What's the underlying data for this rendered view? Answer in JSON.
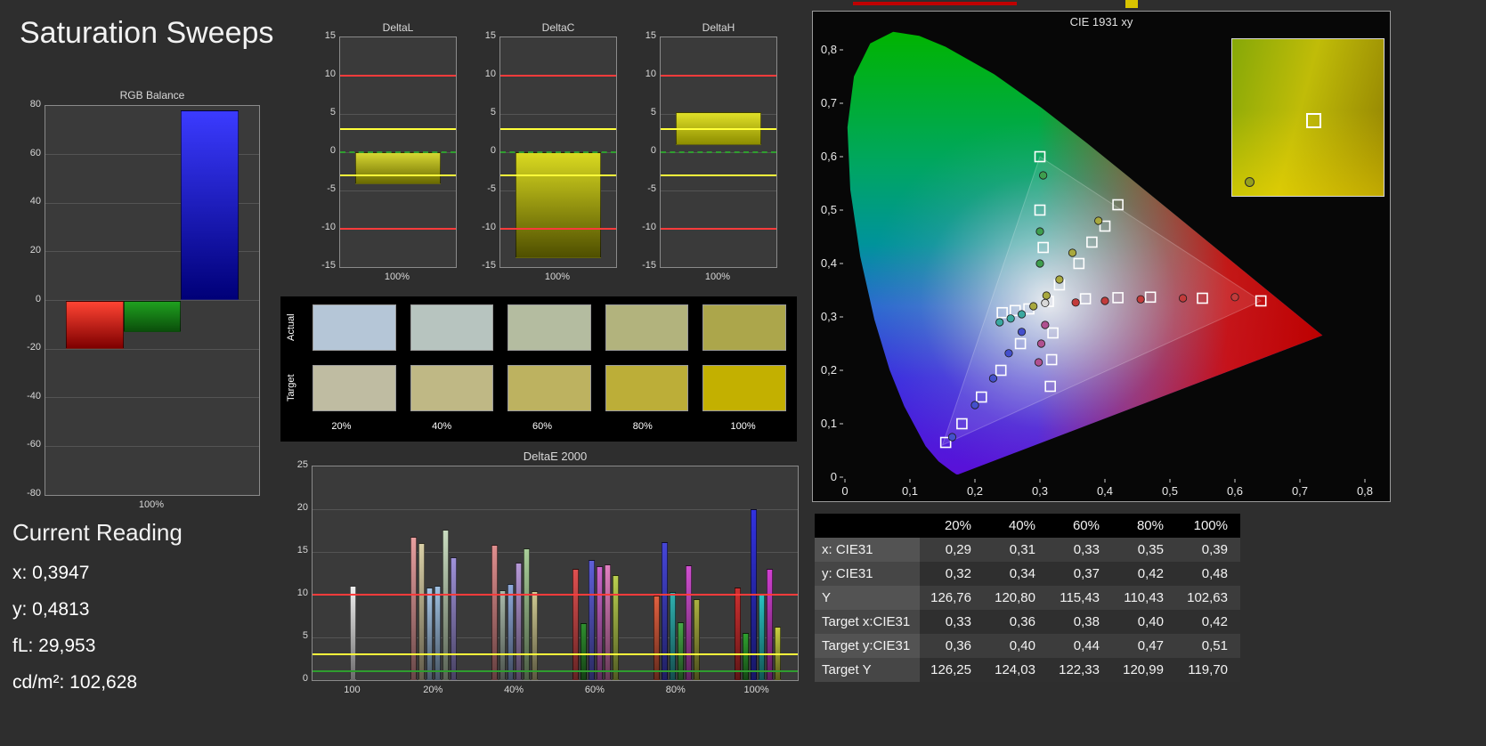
{
  "page": {
    "title": "Saturation Sweeps"
  },
  "current_reading": {
    "heading": "Current Reading",
    "lines": [
      "x: 0,3947",
      "y: 0,4813",
      "fL: 29,953",
      "cd/m²: 102,628"
    ]
  },
  "swatches": {
    "row_labels": [
      "Actual",
      "Target"
    ],
    "column_labels": [
      "20%",
      "40%",
      "60%",
      "80%",
      "100%"
    ],
    "actual_colors": [
      "#b5c6d7",
      "#b7c4bf",
      "#b4bca0",
      "#b2b37d",
      "#aca64b"
    ],
    "target_colors": [
      "#bfbca2",
      "#bfb885",
      "#bdb260",
      "#bcae38",
      "#c3b000"
    ]
  },
  "results_table": {
    "headers": [
      "",
      "20%",
      "40%",
      "60%",
      "80%",
      "100%"
    ],
    "rows": [
      {
        "label": "x: CIE31",
        "values": [
          "0,29",
          "0,31",
          "0,33",
          "0,35",
          "0,39"
        ]
      },
      {
        "label": "y: CIE31",
        "values": [
          "0,32",
          "0,34",
          "0,37",
          "0,42",
          "0,48"
        ]
      },
      {
        "label": "Y",
        "values": [
          "126,76",
          "120,80",
          "115,43",
          "110,43",
          "102,63"
        ]
      },
      {
        "label": "Target x:CIE31",
        "values": [
          "0,33",
          "0,36",
          "0,38",
          "0,40",
          "0,42"
        ]
      },
      {
        "label": "Target y:CIE31",
        "values": [
          "0,36",
          "0,40",
          "0,44",
          "0,47",
          "0,51"
        ]
      },
      {
        "label": "Target Y",
        "values": [
          "126,25",
          "124,03",
          "122,33",
          "120,99",
          "119,70"
        ]
      }
    ]
  },
  "chart_data": [
    {
      "id": "rgb_balance",
      "type": "bar",
      "title": "RGB Balance",
      "ylim": [
        -80,
        80
      ],
      "yticks": [
        80,
        60,
        40,
        20,
        0,
        -20,
        -40,
        -60,
        -80
      ],
      "xticklabels": [
        "100%"
      ],
      "series": [
        {
          "name": "Red",
          "value": -20,
          "color_top": "#ff4433",
          "color_bottom": "#7e0000"
        },
        {
          "name": "Green",
          "value": -13,
          "color_top": "#1fa01f",
          "color_bottom": "#0b4f0b"
        },
        {
          "name": "Blue",
          "value": 78,
          "color_top": "#3b3bff",
          "color_bottom": "#000078"
        }
      ]
    },
    {
      "id": "delta_l",
      "type": "bar",
      "title": "DeltaL",
      "ylim": [
        -15,
        15
      ],
      "yticks": [
        15,
        10,
        5,
        0,
        -5,
        -10,
        -15
      ],
      "xticklabels": [
        "100%"
      ],
      "reference_lines": [
        {
          "value": 10,
          "color": "#ff3b3b"
        },
        {
          "value": 3,
          "color": "#ffff3b"
        },
        {
          "value": 0,
          "color": "#2f9e2f",
          "dashed": true
        },
        {
          "value": -3,
          "color": "#ffff3b"
        },
        {
          "value": -10,
          "color": "#ff3b3b"
        }
      ],
      "bars": [
        {
          "from": 0,
          "to": -4.2,
          "color_top": "#d6d632",
          "color_bottom": "#6a6a00"
        }
      ]
    },
    {
      "id": "delta_c",
      "type": "bar",
      "title": "DeltaC",
      "ylim": [
        -15,
        15
      ],
      "yticks": [
        15,
        10,
        5,
        0,
        -5,
        -10,
        -15
      ],
      "xticklabels": [
        "100%"
      ],
      "reference_lines": [
        {
          "value": 10,
          "color": "#ff3b3b"
        },
        {
          "value": 3,
          "color": "#ffff3b"
        },
        {
          "value": 0,
          "color": "#2f9e2f",
          "dashed": true
        },
        {
          "value": -3,
          "color": "#ffff3b"
        },
        {
          "value": -10,
          "color": "#ff3b3b"
        }
      ],
      "bars": [
        {
          "from": 0,
          "to": -13.8,
          "color_top": "#d9d920",
          "color_bottom": "#4f4f00"
        }
      ]
    },
    {
      "id": "delta_h",
      "type": "bar",
      "title": "DeltaH",
      "ylim": [
        -15,
        15
      ],
      "yticks": [
        15,
        10,
        5,
        0,
        -5,
        -10,
        -15
      ],
      "xticklabels": [
        "100%"
      ],
      "reference_lines": [
        {
          "value": 10,
          "color": "#ff3b3b"
        },
        {
          "value": 3,
          "color": "#ffff3b"
        },
        {
          "value": 0,
          "color": "#2f9e2f",
          "dashed": true
        },
        {
          "value": -3,
          "color": "#ffff3b"
        },
        {
          "value": -10,
          "color": "#ff3b3b"
        }
      ],
      "bars": [
        {
          "from": 0.9,
          "to": 5.2,
          "color_top": "#e0e028",
          "color_bottom": "#8d8d00"
        }
      ]
    },
    {
      "id": "delta_e_2000",
      "type": "grouped_bar",
      "title": "DeltaE 2000",
      "ylim": [
        0,
        25
      ],
      "yticks": [
        25,
        20,
        15,
        10,
        5,
        0
      ],
      "reference_lines": [
        {
          "value": 10,
          "color": "#ff3b3b"
        },
        {
          "value": 3,
          "color": "#ffff3b"
        },
        {
          "value": 1,
          "color": "#2f9e2f"
        }
      ],
      "groups": [
        {
          "label": "100",
          "bars": [
            {
              "color": "#f0f0f0",
              "value": 11.0
            }
          ]
        },
        {
          "label": "20%",
          "bars": [
            {
              "color": "#e89f9f",
              "value": 16.8
            },
            {
              "color": "#d9cfa6",
              "value": 16.0
            },
            {
              "color": "#a6c6e6",
              "value": 10.8
            },
            {
              "color": "#9fc0e0",
              "value": 11.0
            },
            {
              "color": "#c9dcc0",
              "value": 17.6
            },
            {
              "color": "#9f92d9",
              "value": 14.4
            }
          ]
        },
        {
          "label": "40%",
          "bars": [
            {
              "color": "#e08f8f",
              "value": 15.8
            },
            {
              "color": "#a9b9aa",
              "value": 10.5
            },
            {
              "color": "#8fa9d9",
              "value": 11.2
            },
            {
              "color": "#b699d6",
              "value": 13.8
            },
            {
              "color": "#a9cf99",
              "value": 15.4
            },
            {
              "color": "#cfc892",
              "value": 10.4
            }
          ]
        },
        {
          "label": "60%",
          "bars": [
            {
              "color": "#e05050",
              "value": 13.0
            },
            {
              "color": "#2f8f2f",
              "value": 6.7
            },
            {
              "color": "#5f5fd9",
              "value": 14.1
            },
            {
              "color": "#cc66cc",
              "value": 13.3
            },
            {
              "color": "#e080c0",
              "value": 13.5
            },
            {
              "color": "#b9cf50",
              "value": 12.3
            }
          ]
        },
        {
          "label": "80%",
          "bars": [
            {
              "color": "#e06040",
              "value": 9.9
            },
            {
              "color": "#4646d8",
              "value": 16.1
            },
            {
              "color": "#2fb0b0",
              "value": 10.3
            },
            {
              "color": "#46a846",
              "value": 6.8
            },
            {
              "color": "#d050d0",
              "value": 13.4
            },
            {
              "color": "#aab040",
              "value": 9.5
            }
          ]
        },
        {
          "label": "100%",
          "bars": [
            {
              "color": "#d03030",
              "value": 10.8
            },
            {
              "color": "#2fa02f",
              "value": 5.5
            },
            {
              "color": "#3232e0",
              "value": 20.0
            },
            {
              "color": "#28c0c0",
              "value": 10.0
            },
            {
              "color": "#d040d0",
              "value": 13.0
            },
            {
              "color": "#c8d040",
              "value": 6.2
            }
          ]
        }
      ]
    },
    {
      "id": "cie_1931",
      "type": "scatter",
      "title": "CIE 1931 xy",
      "xlim": [
        0,
        0.8
      ],
      "ylim": [
        0,
        0.8
      ],
      "xtick_labels": [
        "0",
        "0,1",
        "0,2",
        "0,3",
        "0,4",
        "0,5",
        "0,6",
        "0,7",
        "0,8"
      ],
      "ytick_labels": [
        "0",
        "0,1",
        "0,2",
        "0,3",
        "0,4",
        "0,5",
        "0,6",
        "0,7",
        "0,8"
      ],
      "gamut_triangle": [
        [
          0.64,
          0.33
        ],
        [
          0.3,
          0.6
        ],
        [
          0.15,
          0.06
        ]
      ],
      "targets": [
        [
          0.33,
          0.36
        ],
        [
          0.36,
          0.4
        ],
        [
          0.38,
          0.44
        ],
        [
          0.4,
          0.47
        ],
        [
          0.42,
          0.51
        ],
        [
          0.37,
          0.334
        ],
        [
          0.42,
          0.336
        ],
        [
          0.47,
          0.337
        ],
        [
          0.55,
          0.335
        ],
        [
          0.64,
          0.33
        ],
        [
          0.305,
          0.43
        ],
        [
          0.3,
          0.5
        ],
        [
          0.3,
          0.6
        ],
        [
          0.27,
          0.25
        ],
        [
          0.24,
          0.2
        ],
        [
          0.21,
          0.15
        ],
        [
          0.18,
          0.1
        ],
        [
          0.155,
          0.065
        ],
        [
          0.32,
          0.27
        ],
        [
          0.318,
          0.22
        ],
        [
          0.316,
          0.17
        ],
        [
          0.283,
          0.315
        ],
        [
          0.262,
          0.312
        ],
        [
          0.242,
          0.308
        ],
        [
          0.313,
          0.329
        ]
      ],
      "measurements": [
        {
          "x": 0.29,
          "y": 0.32,
          "color": "#a8a83e"
        },
        {
          "x": 0.31,
          "y": 0.34,
          "color": "#a8a83e"
        },
        {
          "x": 0.33,
          "y": 0.37,
          "color": "#a8a83e"
        },
        {
          "x": 0.35,
          "y": 0.42,
          "color": "#a8a83e"
        },
        {
          "x": 0.39,
          "y": 0.48,
          "color": "#a8a83e"
        },
        {
          "x": 0.355,
          "y": 0.327,
          "color": "#c23b3b"
        },
        {
          "x": 0.4,
          "y": 0.33,
          "color": "#c23b3b"
        },
        {
          "x": 0.455,
          "y": 0.333,
          "color": "#c23b3b"
        },
        {
          "x": 0.52,
          "y": 0.335,
          "color": "#c23b3b"
        },
        {
          "x": 0.6,
          "y": 0.337,
          "color": "#c23b3b"
        },
        {
          "x": 0.3,
          "y": 0.4,
          "color": "#3e9e4e"
        },
        {
          "x": 0.3,
          "y": 0.46,
          "color": "#3e9e4e"
        },
        {
          "x": 0.305,
          "y": 0.565,
          "color": "#3e9e4e"
        },
        {
          "x": 0.272,
          "y": 0.272,
          "color": "#4450cc"
        },
        {
          "x": 0.252,
          "y": 0.232,
          "color": "#4450cc"
        },
        {
          "x": 0.228,
          "y": 0.185,
          "color": "#4450cc"
        },
        {
          "x": 0.2,
          "y": 0.135,
          "color": "#4450cc"
        },
        {
          "x": 0.165,
          "y": 0.075,
          "color": "#4450cc"
        },
        {
          "x": 0.308,
          "y": 0.285,
          "color": "#b05090"
        },
        {
          "x": 0.302,
          "y": 0.25,
          "color": "#b05090"
        },
        {
          "x": 0.298,
          "y": 0.215,
          "color": "#b05090"
        },
        {
          "x": 0.272,
          "y": 0.305,
          "color": "#3aa8a0"
        },
        {
          "x": 0.255,
          "y": 0.297,
          "color": "#3aa8a0"
        },
        {
          "x": 0.238,
          "y": 0.29,
          "color": "#3aa8a0"
        },
        {
          "x": 0.308,
          "y": 0.326,
          "color": "#d8d8d8"
        }
      ],
      "inset": {
        "marker_square": [
          0.49,
          0.47
        ],
        "marker_dot": [
          0.08,
          0.88
        ]
      }
    }
  ]
}
